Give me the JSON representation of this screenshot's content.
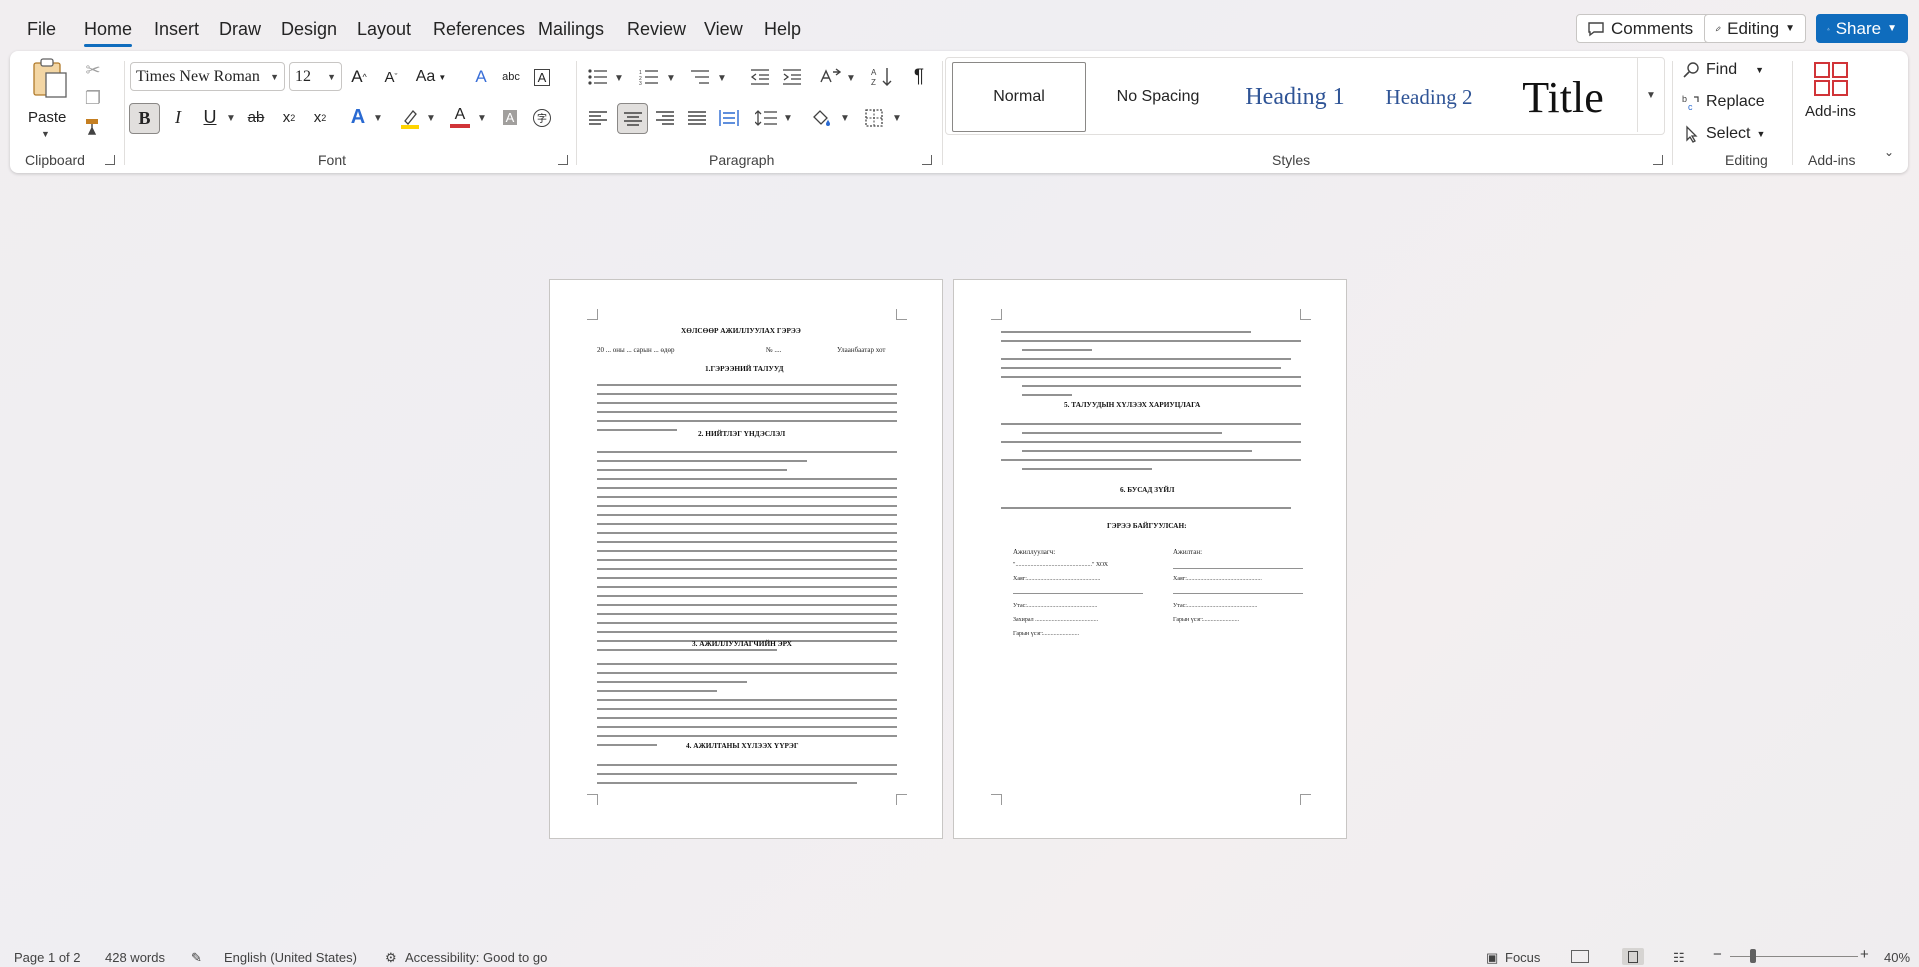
{
  "menu": {
    "tabs": [
      {
        "label": "File"
      },
      {
        "label": "Home"
      },
      {
        "label": "Insert"
      },
      {
        "label": "Draw"
      },
      {
        "label": "Design"
      },
      {
        "label": "Layout"
      },
      {
        "label": "References"
      },
      {
        "label": "Mailings"
      },
      {
        "label": "Review"
      },
      {
        "label": "View"
      },
      {
        "label": "Help"
      }
    ],
    "active": "Home",
    "comments_label": "Comments",
    "editing_label": "Editing",
    "share_label": "Share"
  },
  "ribbon": {
    "clipboard": {
      "paste_label": "Paste",
      "group_label": "Clipboard"
    },
    "font": {
      "name": "Times New Roman",
      "size": "12",
      "group_label": "Font",
      "grow": "A^",
      "shrink": "A˅",
      "case": "Aa"
    },
    "paragraph": {
      "group_label": "Paragraph"
    },
    "styles": {
      "group_label": "Styles",
      "items": [
        {
          "label": "Normal"
        },
        {
          "label": "No Spacing"
        },
        {
          "label": "Heading 1"
        },
        {
          "label": "Heading 2"
        },
        {
          "label": "Title"
        }
      ]
    },
    "editing": {
      "group_label": "Editing",
      "find": "Find",
      "replace": "Replace",
      "select": "Select"
    },
    "addins": {
      "label": "Add-ins",
      "group_label": "Add-ins"
    }
  },
  "document": {
    "page1": {
      "title": "ХӨЛСӨӨР АЖИЛЛУУЛАХ ГЭРЭЭ",
      "date_line_left": "20 ... оны ... сарын ... өдөр",
      "date_line_mid": "№ ....",
      "date_line_right": "Улаанбаатар хот",
      "s1": "1.ГЭРЭЭНИЙ ТАЛУУД",
      "s2": "2. НИЙТЛЭГ ҮНДЭСЛЭЛ",
      "s3": "3. АЖИЛЛУУЛАГЧИЙН ЭРХ",
      "s4": "4. АЖИЛТАНЫ ХҮЛЭЭХ ҮҮРЭГ"
    },
    "page2": {
      "s5": "5.        ТАЛУУДЫН ХҮЛЭЭХ ХАРИУЦЛАГА",
      "s6": "6.   БУСАД ЗҮЙЛ",
      "sign_title": "ГЭРЭЭ БАЙГУУЛСАН:",
      "employer_label": "Ажиллуулагч:",
      "employee_label": "Ажилтан:",
      "employer_company": "\"...................................................\" ХОХ",
      "address_left": "Хаяг:.................................................",
      "address_right": "Хаяг:..................................................",
      "phone_left": "Утас:...............................................",
      "phone_right": "Утас:...............................................",
      "director": "Захирал ..........................................",
      "sign_left": "Гарын үсэг:........................",
      "sign_right": "Гарын үсэг:........................"
    }
  },
  "status": {
    "page": "Page 1 of 2",
    "words": "428 words",
    "language": "English (United States)",
    "accessibility": "Accessibility: Good to go",
    "focus": "Focus",
    "zoom": "40%"
  },
  "colors": {
    "accent": "#0f6cbd",
    "font_red": "#d13438",
    "highlight_yellow": "#ffd400"
  }
}
